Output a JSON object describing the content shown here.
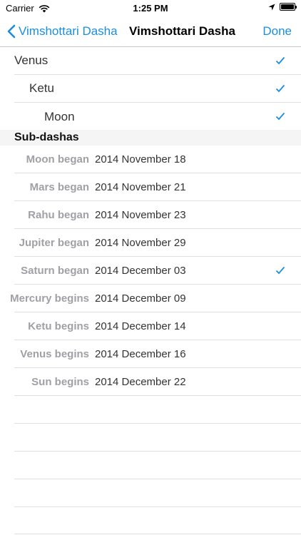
{
  "status": {
    "carrier": "Carrier",
    "time": "1:25 PM"
  },
  "nav": {
    "back_label": "Vimshottari Dasha",
    "title": "Vimshottari Dasha",
    "done_label": "Done"
  },
  "hierarchy": [
    {
      "label": "Venus",
      "checked": true
    },
    {
      "label": "Ketu",
      "checked": true
    },
    {
      "label": "Moon",
      "checked": true
    }
  ],
  "section": {
    "title": "Sub-dashas"
  },
  "subdashas": [
    {
      "label": "Moon began",
      "date": "2014 November 18",
      "checked": false
    },
    {
      "label": "Mars began",
      "date": "2014 November 21",
      "checked": false
    },
    {
      "label": "Rahu began",
      "date": "2014 November 23",
      "checked": false
    },
    {
      "label": "Jupiter began",
      "date": "2014 November 29",
      "checked": false
    },
    {
      "label": "Saturn began",
      "date": "2014 December 03",
      "checked": true
    },
    {
      "label": "Mercury begins",
      "date": "2014 December 09",
      "checked": false
    },
    {
      "label": "Ketu begins",
      "date": "2014 December 14",
      "checked": false
    },
    {
      "label": "Venus begins",
      "date": "2014 December 16",
      "checked": false
    },
    {
      "label": "Sun begins",
      "date": "2014 December 22",
      "checked": false
    }
  ],
  "colors": {
    "accent": "#1a8ee0",
    "label_gray": "#a0a0a5",
    "separator": "#e0e0e3"
  },
  "icons": {
    "back": "chevron-left-icon",
    "check": "checkmark-icon",
    "wifi": "wifi-icon",
    "location": "location-arrow-icon",
    "battery": "battery-icon"
  }
}
